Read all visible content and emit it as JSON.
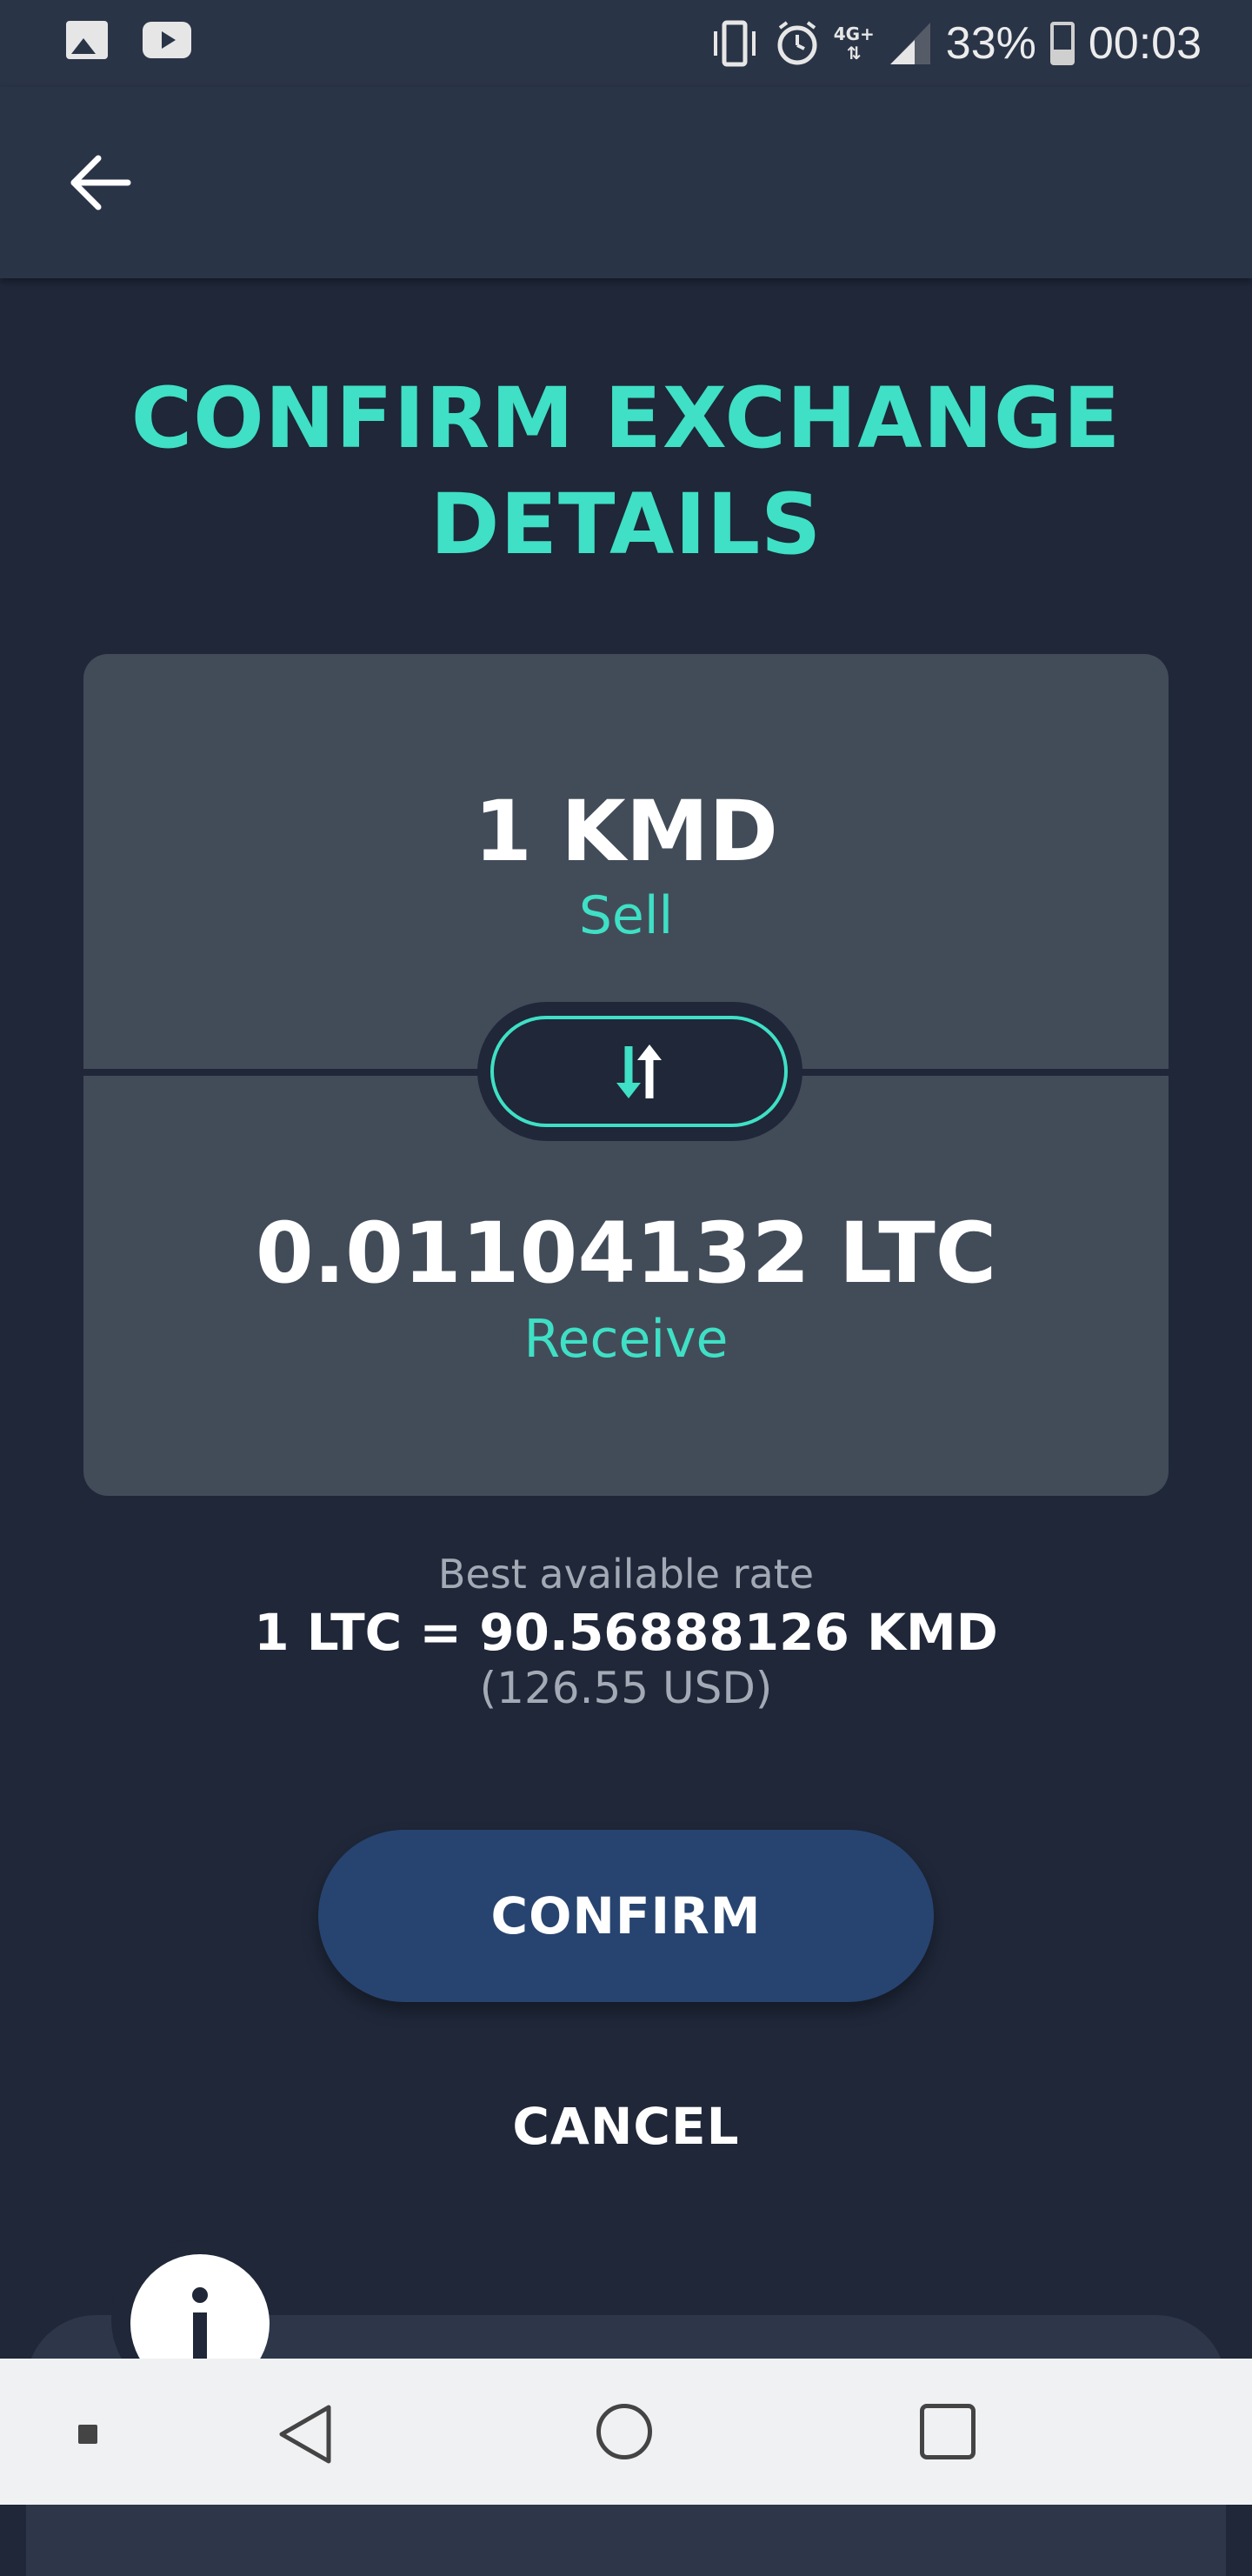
{
  "status_bar": {
    "battery_percent": "33%",
    "time": "00:03",
    "network": "4G+",
    "icons": [
      "image-icon",
      "youtube-icon",
      "vibrate-icon",
      "alarm-icon",
      "network-4g-icon",
      "signal-icon",
      "battery-icon"
    ]
  },
  "header": {
    "back_icon": "arrow-left-icon"
  },
  "title": {
    "line1": "CONFIRM EXCHANGE",
    "line2": "DETAILS"
  },
  "exchange": {
    "sell_amount": "1 KMD",
    "sell_label": "Sell",
    "receive_amount": "0.01104132 LTC",
    "receive_label": "Receive",
    "swap_icon": "swap-arrows-icon"
  },
  "rate": {
    "label": "Best available rate",
    "value": "1 LTC = 90.56888126 KMD",
    "usd": "(126.55 USD)"
  },
  "actions": {
    "confirm_label": "CONFIRM",
    "cancel_label": "CANCEL"
  },
  "colors": {
    "background": "#1f2739",
    "header": "#2a3447",
    "accent": "#3fe0c5",
    "card": "#424c59",
    "confirm_button": "#274470"
  }
}
